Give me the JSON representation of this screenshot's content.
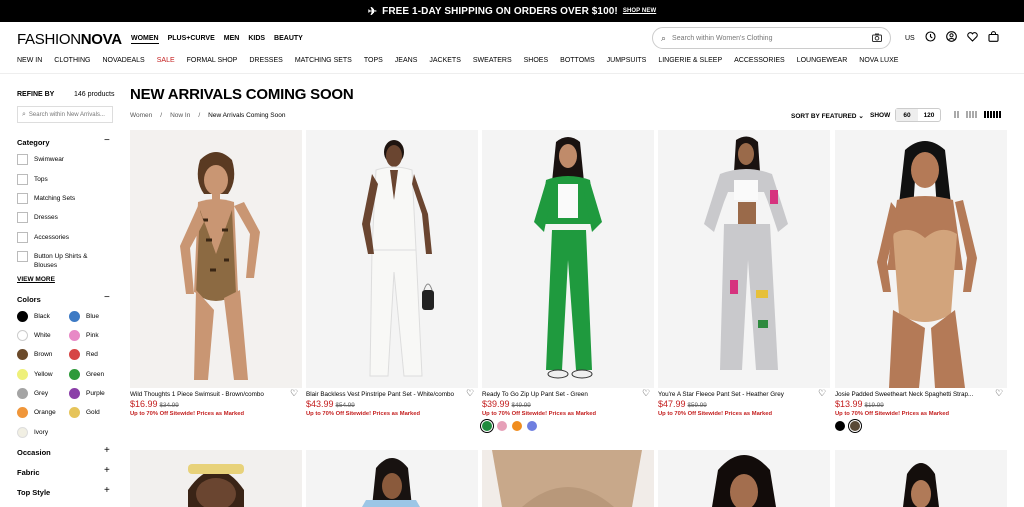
{
  "banner": {
    "text": "FREE 1-DAY SHIPPING ON ORDERS OVER $100!",
    "link": "SHOP NEW"
  },
  "logo": {
    "part1": "FASHION",
    "part2": "NOVA"
  },
  "top_nav": [
    "WOMEN",
    "PLUS+CURVE",
    "MEN",
    "KIDS",
    "BEAUTY"
  ],
  "search": {
    "placeholder": "Search within Women's Clothing"
  },
  "header_icons": {
    "locale": "US"
  },
  "category_nav": [
    "NEW IN",
    "CLOTHING",
    "NOVADEALS",
    "SALE",
    "FORMAL SHOP",
    "DRESSES",
    "MATCHING SETS",
    "TOPS",
    "JEANS",
    "JACKETS",
    "SWEATERS",
    "SHOES",
    "BOTTOMS",
    "JUMPSUITS",
    "LINGERIE & SLEEP",
    "ACCESSORIES",
    "LOUNGEWEAR",
    "NOVA LUXE"
  ],
  "sidebar": {
    "refine_by": "REFINE BY",
    "product_count": "146 products",
    "search_placeholder": "Search within New Arrivals...",
    "category_title": "Category",
    "categories": [
      "Swimwear",
      "Tops",
      "Matching Sets",
      "Dresses",
      "Accessories",
      "Button Up Shirts & Blouses"
    ],
    "view_more": "VIEW MORE",
    "colors_title": "Colors",
    "colors": [
      {
        "name": "Black",
        "hex": "#000000"
      },
      {
        "name": "Blue",
        "hex": "#3d7ac4"
      },
      {
        "name": "White",
        "hex": "#ffffff"
      },
      {
        "name": "Pink",
        "hex": "#e889c6"
      },
      {
        "name": "Brown",
        "hex": "#6b4a2b"
      },
      {
        "name": "Red",
        "hex": "#d64545"
      },
      {
        "name": "Yellow",
        "hex": "#eef07a"
      },
      {
        "name": "Green",
        "hex": "#2e9a3a"
      },
      {
        "name": "Grey",
        "hex": "#a4a4a4"
      },
      {
        "name": "Purple",
        "hex": "#8b3fa8"
      },
      {
        "name": "Orange",
        "hex": "#f0963a"
      },
      {
        "name": "Gold",
        "hex": "#e6c45a"
      },
      {
        "name": "Ivory",
        "hex": "#f1efe3"
      }
    ],
    "occasion_title": "Occasion",
    "fabric_title": "Fabric",
    "top_style_title": "Top Style"
  },
  "main": {
    "title": "NEW ARRIVALS COMING SOON",
    "breadcrumb": [
      "Women",
      "Now In",
      "New Arrivals Coming Soon"
    ],
    "sort_label": "SORT BY FEATURED",
    "show_label": "SHOW",
    "show_options": [
      "60",
      "120"
    ]
  },
  "products": [
    {
      "name": "Wild Thoughts 1 Piece Swimsuit - Brown/combo",
      "price": "$16.99",
      "old_price": "$34.99",
      "promo": "Up to 70% Off Sitewide! Prices as Marked",
      "swatches": []
    },
    {
      "name": "Blair Backless Vest Pinstripe Pant Set - White/combo",
      "price": "$43.99",
      "old_price": "$54.99",
      "promo": "Up to 70% Off Sitewide! Prices as Marked",
      "swatches": []
    },
    {
      "name": "Ready To Go Zip Up Pant Set - Green",
      "price": "$39.99",
      "old_price": "$49.99",
      "promo": "Up to 70% Off Sitewide! Prices as Marked",
      "swatches": [
        "#1f8b3d",
        "#e6a0b8",
        "#f08c1e",
        "#6f7fe0"
      ]
    },
    {
      "name": "You're A Star Fleece Pant Set - Heather Grey",
      "price": "$47.99",
      "old_price": "$59.99",
      "promo": "Up to 70% Off Sitewide! Prices as Marked",
      "swatches": []
    },
    {
      "name": "Josie Padded Sweetheart Neck Spaghetti Strap...",
      "price": "$13.99",
      "old_price": "$19.99",
      "promo": "Up to 70% Off Sitewide! Prices as Marked",
      "swatches": [
        "#000000",
        "#5a4a38"
      ]
    }
  ]
}
